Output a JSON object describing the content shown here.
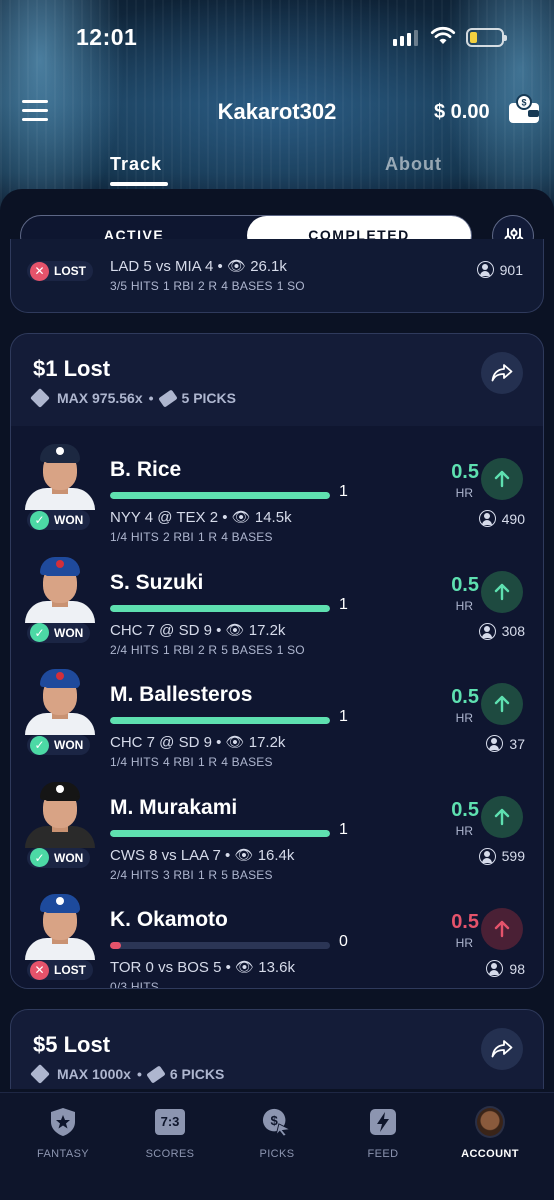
{
  "status_bar": {
    "time": "12:01"
  },
  "header": {
    "username": "Kakarot302",
    "balance": "$ 0.00"
  },
  "tabs": [
    {
      "label": "Track"
    },
    {
      "label": "About"
    }
  ],
  "segment": {
    "active_label": "ACTIVE",
    "completed_label": "COMPLETED"
  },
  "prev_card_pick": {
    "result": "LOST",
    "game": "LAD 5 vs MIA 4",
    "views": "26.1k",
    "stats": [
      "3/5 HITS",
      "1 RBI",
      "2 R",
      "4 BASES",
      "1 SO"
    ],
    "users": "901"
  },
  "entry_card": {
    "title": "$1 Lost",
    "max": "MAX 975.56x",
    "picks_count": "5 PICKS",
    "picks": [
      {
        "name": "B. Rice",
        "result": "WON",
        "progress_value": "1",
        "progress_fraction": 1.0,
        "line": "0.5",
        "market": "HR",
        "direction": "up",
        "game": "NYY 4 @ TEX 2",
        "views": "14.5k",
        "stats": [
          "1/4 HITS",
          "2 RBI",
          "1 R",
          "4 BASES"
        ],
        "users": "490",
        "team": "NYY",
        "cap_color": "#1c2841",
        "logo_color": "#ffffff",
        "jersey_color": "#eef1f5"
      },
      {
        "name": "S. Suzuki",
        "result": "WON",
        "progress_value": "1",
        "progress_fraction": 1.0,
        "line": "0.5",
        "market": "HR",
        "direction": "up",
        "game": "CHC 7 @ SD 9",
        "views": "17.2k",
        "stats": [
          "2/4 HITS",
          "1 RBI",
          "2 R",
          "5 BASES",
          "1 SO"
        ],
        "users": "308",
        "team": "CHC",
        "cap_color": "#1f4a9c",
        "logo_color": "#d32f3a",
        "jersey_color": "#eef1f5"
      },
      {
        "name": "M. Ballesteros",
        "result": "WON",
        "progress_value": "1",
        "progress_fraction": 1.0,
        "line": "0.5",
        "market": "HR",
        "direction": "up",
        "game": "CHC 7 @ SD 9",
        "views": "17.2k",
        "stats": [
          "1/4 HITS",
          "4 RBI",
          "1 R",
          "4 BASES"
        ],
        "users": "37",
        "team": "CHC",
        "cap_color": "#1f4a9c",
        "logo_color": "#d32f3a",
        "jersey_color": "#eef1f5"
      },
      {
        "name": "M. Murakami",
        "result": "WON",
        "progress_value": "1",
        "progress_fraction": 1.0,
        "line": "0.5",
        "market": "HR",
        "direction": "up",
        "game": "CWS 8 vs LAA 7",
        "views": "16.4k",
        "stats": [
          "2/4 HITS",
          "3 RBI",
          "1 R",
          "5 BASES"
        ],
        "users": "599",
        "team": "CWS",
        "cap_color": "#151515",
        "logo_color": "#ffffff",
        "jersey_color": "#2a2a2a"
      },
      {
        "name": "K. Okamoto",
        "result": "LOST",
        "progress_value": "0",
        "progress_fraction": 0.05,
        "line": "0.5",
        "market": "HR",
        "direction": "down",
        "game": "TOR 0 vs BOS 5",
        "views": "13.6k",
        "stats": [
          "0/3 HITS"
        ],
        "users": "98",
        "team": "TOR",
        "cap_color": "#1d4a9c",
        "logo_color": "#ffffff",
        "jersey_color": "#eef1f5"
      }
    ]
  },
  "next_card": {
    "title": "$5 Lost",
    "max": "MAX 1000x",
    "picks_count": "6 PICKS"
  },
  "bottom_nav": [
    {
      "label": "FANTASY",
      "icon": "fantasy-shield-star-icon"
    },
    {
      "label": "SCORES",
      "icon": "scoreboard-icon",
      "icon_text": "7:3"
    },
    {
      "label": "PICKS",
      "icon": "picks-dollar-icon"
    },
    {
      "label": "FEED",
      "icon": "feed-lightning-icon"
    },
    {
      "label": "ACCOUNT",
      "icon": "account-avatar-icon",
      "active": true
    }
  ],
  "colors": {
    "won": "#4cd9a5",
    "lost": "#e5536b",
    "background": "#0b1224"
  }
}
